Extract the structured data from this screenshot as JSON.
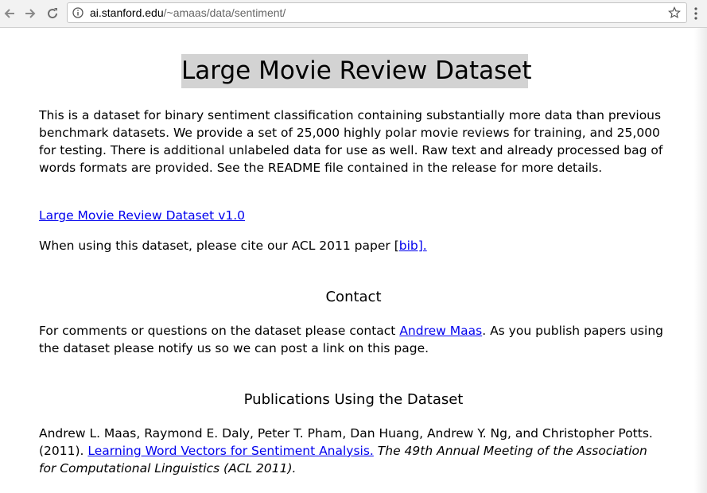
{
  "browser": {
    "url_domain": "ai.stanford.edu",
    "url_path": "/~amaas/data/sentiment/"
  },
  "page": {
    "title": "Large Movie Review Dataset",
    "intro": "This is a dataset for binary sentiment classification containing substantially more data than previous benchmark datasets. We provide a set of 25,000 highly polar movie reviews for training, and 25,000 for testing. There is additional unlabeled data for use as well. Raw text and already processed bag of words formats are provided. See the README file contained in the release for more details.",
    "dataset_link": "Large Movie Review Dataset v1.0",
    "cite_prefix": "When using this dataset, please cite our ACL 2011 paper ",
    "cite_open": "[",
    "bib_link": "bib].",
    "contact_heading": "Contact",
    "contact_prefix": "For comments or questions on the dataset please contact ",
    "contact_link": "Andrew Maas",
    "contact_suffix": ". As you publish papers using the dataset please notify us so we can post a link on this page.",
    "publications_heading": "Publications Using the Dataset",
    "pub_authors": "Andrew L. Maas, Raymond E. Daly, Peter T. Pham, Dan Huang, Andrew Y. Ng, and Christopher Potts. (2011). ",
    "pub_link": "Learning Word Vectors for Sentiment Analysis.",
    "pub_venue": "The 49th Annual Meeting of the Association for Computational Linguistics (ACL 2011)."
  },
  "icons": [
    "back-arrow-icon",
    "forward-arrow-icon",
    "reload-icon",
    "info-icon",
    "star-icon",
    "menu-icon"
  ],
  "colors": {
    "link": "#0000ee",
    "title_bg": "#d3d3d3",
    "toolbar_bg": "#f2f2f2"
  }
}
